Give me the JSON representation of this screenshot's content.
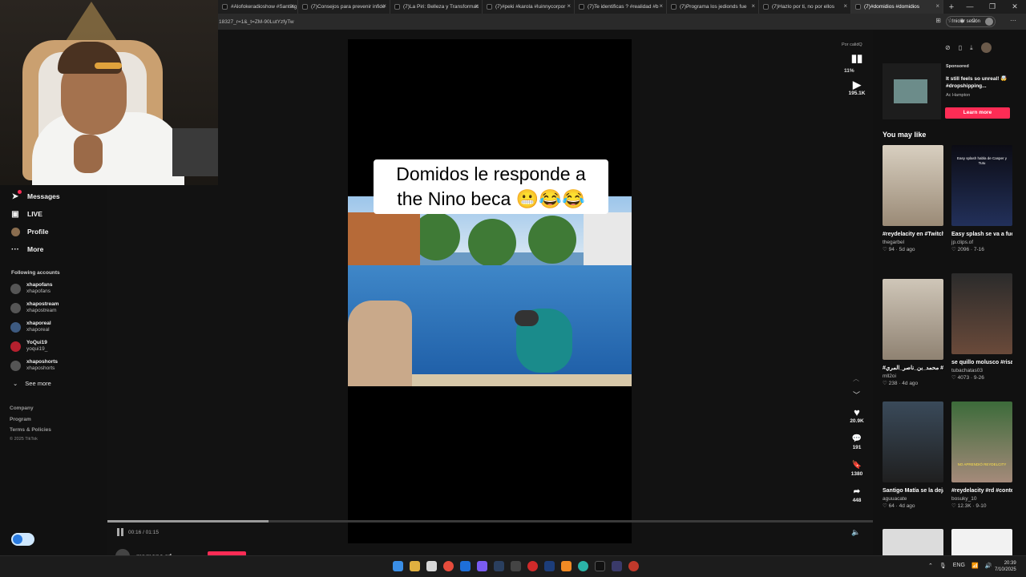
{
  "browser": {
    "tabs": [
      {
        "label": "#Alofokeradioshow #Santiag",
        "active": false
      },
      {
        "label": "(7)Consejos para prevenir infide",
        "active": false
      },
      {
        "label": "(7)La Piri: Belleza y Transformac",
        "active": false
      },
      {
        "label": "(7)#peki #karola #luinnycorpor",
        "active": false
      },
      {
        "label": "(7)Te identificas ? #realidad #b",
        "active": false
      },
      {
        "label": "(7)Programa los jedionds fue",
        "active": false
      },
      {
        "label": "(7)Hazlo por ti, no por ellos",
        "active": false
      },
      {
        "label": "(7)#domidios #domidios",
        "active": true
      }
    ],
    "url": "18327_r=1&_t=ZM-90LutYzfyTw",
    "signin_label": "Iniciar sesión"
  },
  "sidebar": {
    "nav": [
      {
        "label": "Messages",
        "icon": "paper-plane-icon"
      },
      {
        "label": "LIVE",
        "icon": "live-tv-icon"
      },
      {
        "label": "Profile",
        "icon": "profile-avatar-icon"
      },
      {
        "label": "More",
        "icon": "more-dots-icon"
      }
    ],
    "following_title": "Following accounts",
    "accounts": [
      {
        "name": "xhapofans",
        "handle": "xhapofans"
      },
      {
        "name": "xhapostream",
        "handle": "xhapostream"
      },
      {
        "name": "xhaporeal",
        "handle": "xhaporeal"
      },
      {
        "name": "YoQui19",
        "handle": "yoqui19_"
      },
      {
        "name": "xhaposhorts",
        "handle": "xhaposhorts"
      }
    ],
    "see_more": "See more",
    "footer": [
      "Company",
      "Program",
      "Terms & Policies"
    ],
    "copyright": "© 2025 TikTok"
  },
  "video": {
    "caption_line1": "Domidos le responde a",
    "caption_line2": "the Nino beca 😬😂😂",
    "progress": 0.21,
    "time": "00:16 / 01:15",
    "author": "mr.mono.rd"
  },
  "rail": {
    "quality": "Por calidQ",
    "percent": "11%",
    "plays": "195.1K",
    "likes": "20.9K",
    "comments": "191",
    "saves": "1380",
    "shares": "448"
  },
  "ad": {
    "sponsored": "Sponsored",
    "text": "It still feels so unreal! 🤯 #dropshipping...",
    "author": "Ac Hampton",
    "cta": "Learn more"
  },
  "you_may_like": "You may like",
  "cards": [
    {
      "title": "#reydelacity en #Twitch |...",
      "author": "thegarbel",
      "likes": "94",
      "age": "5d ago",
      "thumb_text": ""
    },
    {
      "title": "Easy splash se va a fuego contra Casp...",
      "author": "jp.clips.of",
      "likes": "2096",
      "age": "7-16",
      "thumb_text": "Easy splash habla de Casper y Tutu"
    },
    {
      "title": "#محمد_بن_ناصر_المري #viral #foryou #fyp",
      "author": "mll2oi",
      "likes": "238",
      "age": "4d ago",
      "thumb_text": ""
    },
    {
      "title": "se quillo molusco #risa #comedia...",
      "author": "tubachatas03",
      "likes": "4073",
      "age": "9-26",
      "thumb_text": ""
    },
    {
      "title": "Santigo Matía se la deja caer a El Alfa,...",
      "author": "aguuacate",
      "likes": "64",
      "age": "4d ago",
      "thumb_text": ""
    },
    {
      "title": "#reydelacity #rd #contenido #Viral...",
      "author": "bosuky_10",
      "likes": "12.3K",
      "age": "9-10",
      "thumb_text": "NO APRENDIÓ REYDELCITY"
    }
  ],
  "taskbar": {
    "lang": "ENG",
    "time": "20:39",
    "date": "7/10/2025"
  },
  "colors": {
    "accent": "#fe2c55",
    "background": "#121212"
  }
}
